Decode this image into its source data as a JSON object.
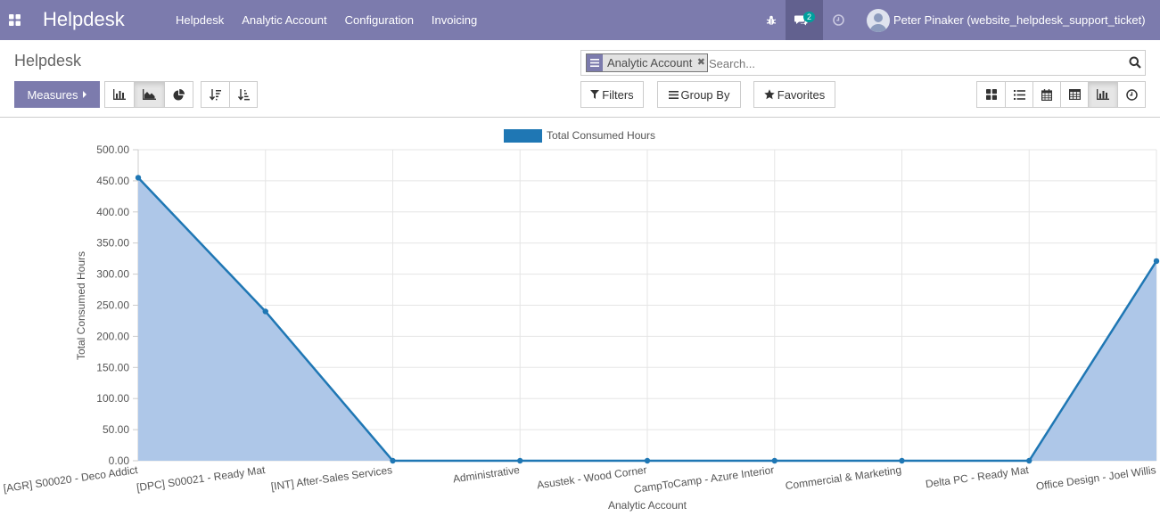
{
  "navbar": {
    "brand": "Helpdesk",
    "menu": [
      "Helpdesk",
      "Analytic Account",
      "Configuration",
      "Invoicing"
    ],
    "messages_badge": "2",
    "user": "Peter Pinaker (website_helpdesk_support_ticket)",
    "accent": "#7c7bad"
  },
  "control_panel": {
    "breadcrumb": "Helpdesk",
    "measures_label": "Measures",
    "search": {
      "facet_value": "Analytic Account",
      "placeholder": "Search..."
    },
    "filters_label": "Filters",
    "group_by_label": "Group By",
    "favorites_label": "Favorites"
  },
  "chart_data": {
    "type": "area",
    "legend": "Total Consumed Hours",
    "legend_position": "top",
    "xlabel": "Analytic Account",
    "ylabel": "Total Consumed Hours",
    "ylim": [
      0,
      500
    ],
    "yticks": [
      "0.00",
      "50.00",
      "100.00",
      "150.00",
      "200.00",
      "250.00",
      "300.00",
      "350.00",
      "400.00",
      "450.00",
      "500.00"
    ],
    "categories": [
      "[AGR] S00020 - Deco Addict",
      "[DPC] S00021 - Ready Mat",
      "[INT] After-Sales Services",
      "Administrative",
      "Asustek - Wood Corner",
      "CampToCamp - Azure Interior",
      "Commercial & Marketing",
      "Delta PC - Ready Mat",
      "Office Design - Joel Willis"
    ],
    "values": [
      455,
      240,
      0,
      0,
      0,
      0,
      0,
      0,
      321
    ],
    "grid": true,
    "line_color": "#1f77b4",
    "fill_color": "#aec7e8"
  }
}
